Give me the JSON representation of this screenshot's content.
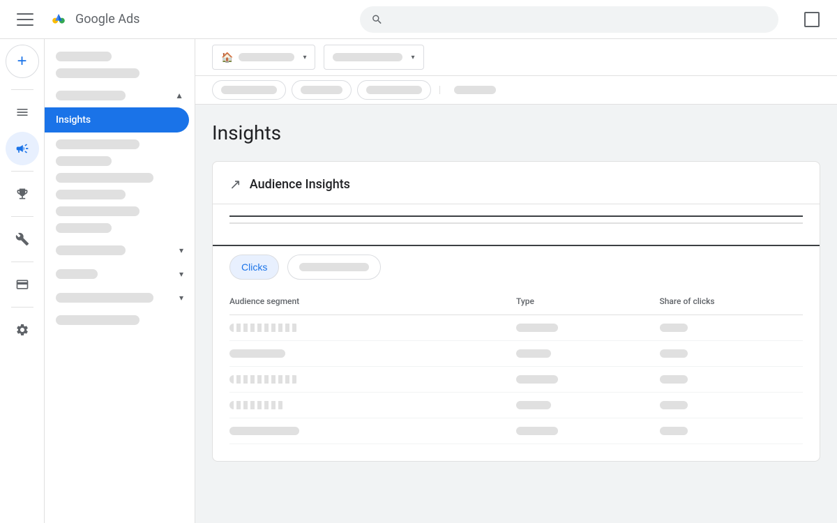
{
  "app": {
    "name": "Google Ads",
    "title": "Insights"
  },
  "nav": {
    "menu_label": "Menu",
    "search_placeholder": "",
    "icons": [
      "menu",
      "megaphone",
      "trophy",
      "tools",
      "credit-card",
      "settings"
    ]
  },
  "toolbar": {
    "dropdown1_label": "",
    "dropdown2_label": "",
    "filter_label": ""
  },
  "sidebar": {
    "active_item": "Insights",
    "items": [
      "",
      "",
      "",
      "",
      "",
      "",
      "",
      "",
      "",
      "",
      "",
      ""
    ]
  },
  "card": {
    "title": "Audience Insights",
    "tabs": {
      "primary": "Clicks",
      "secondary_placeholder": ""
    },
    "table": {
      "columns": [
        "Audience segment",
        "Type",
        "Share of clicks"
      ],
      "rows": [
        {
          "segment": "",
          "type": "",
          "share": ""
        },
        {
          "segment": "",
          "type": "",
          "share": ""
        },
        {
          "segment": "",
          "type": "",
          "share": ""
        },
        {
          "segment": "",
          "type": "",
          "share": ""
        },
        {
          "segment": "",
          "type": "",
          "share": ""
        }
      ]
    }
  }
}
